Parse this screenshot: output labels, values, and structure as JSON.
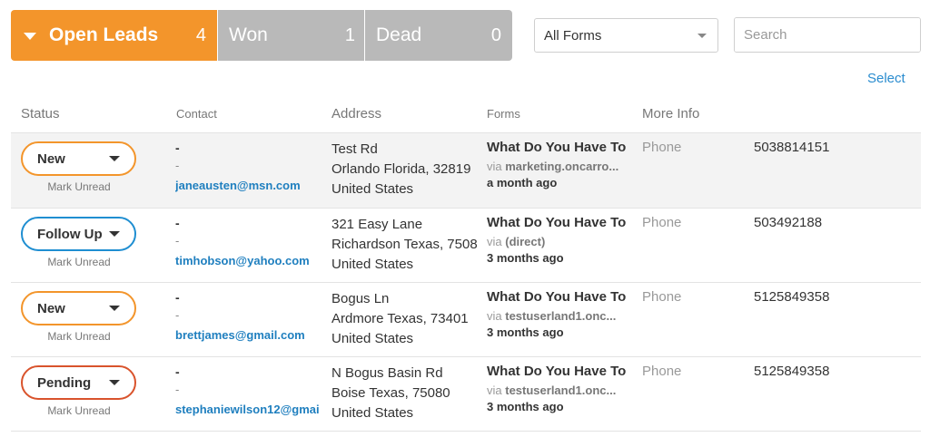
{
  "tabs": {
    "open": {
      "label": "Open Leads",
      "count": "4"
    },
    "won": {
      "label": "Won",
      "count": "1"
    },
    "dead": {
      "label": "Dead",
      "count": "0"
    }
  },
  "filter": {
    "selected": "All Forms"
  },
  "search": {
    "placeholder": "Search"
  },
  "select_link": "Select",
  "headers": {
    "status": "Status",
    "contact": "Contact",
    "address": "Address",
    "forms": "Forms",
    "more_info": "More Info"
  },
  "leads": [
    {
      "status": "New",
      "mark_unread": "Mark Unread",
      "name": "-",
      "phone": "-",
      "email": "janeausten@msn.com",
      "address": [
        "Test Rd",
        "Orlando Florida, 32819",
        "United States"
      ],
      "form_name": "What Do You Have To",
      "via_prefix": "via ",
      "via": "marketing.oncarro...",
      "time": "a month ago",
      "info_label": "Phone",
      "info_value": "5038814151"
    },
    {
      "status": "Follow Up",
      "mark_unread": "Mark Unread",
      "name": "-",
      "phone": "-",
      "email": "timhobson@yahoo.com",
      "address": [
        "321 Easy Lane",
        "Richardson Texas, 7508",
        "United States"
      ],
      "form_name": "What Do You Have To",
      "via_prefix": "via ",
      "via": "(direct)",
      "time": "3 months ago",
      "info_label": "Phone",
      "info_value": "503492188"
    },
    {
      "status": "New",
      "mark_unread": "Mark Unread",
      "name": "-",
      "phone": "-",
      "email": "brettjames@gmail.com",
      "address": [
        "Bogus Ln",
        "Ardmore Texas, 73401",
        "United States"
      ],
      "form_name": "What Do You Have To",
      "via_prefix": "via ",
      "via": "testuserland1.onc...",
      "time": "3 months ago",
      "info_label": "Phone",
      "info_value": "5125849358"
    },
    {
      "status": "Pending",
      "mark_unread": "Mark Unread",
      "name": "-",
      "phone": "-",
      "email": "stephaniewilson12@gmai",
      "address": [
        "N Bogus Basin Rd",
        "Boise Texas, 75080",
        "United States"
      ],
      "form_name": "What Do You Have To",
      "via_prefix": "via ",
      "via": "testuserland1.onc...",
      "time": "3 months ago",
      "info_label": "Phone",
      "info_value": "5125849358"
    }
  ],
  "colors": {
    "accent_orange": "#f3952b",
    "tab_gray": "#b9b9b9",
    "link_blue": "#2a8ccf",
    "status_new": "#f3952b",
    "status_follow_up": "#1f8ed1",
    "status_pending": "#d9532c"
  },
  "icons": {
    "open_tab": "caret-down-icon",
    "filter": "chevron-down-icon",
    "search": "magnifier-icon",
    "status": "caret-down-icon"
  }
}
